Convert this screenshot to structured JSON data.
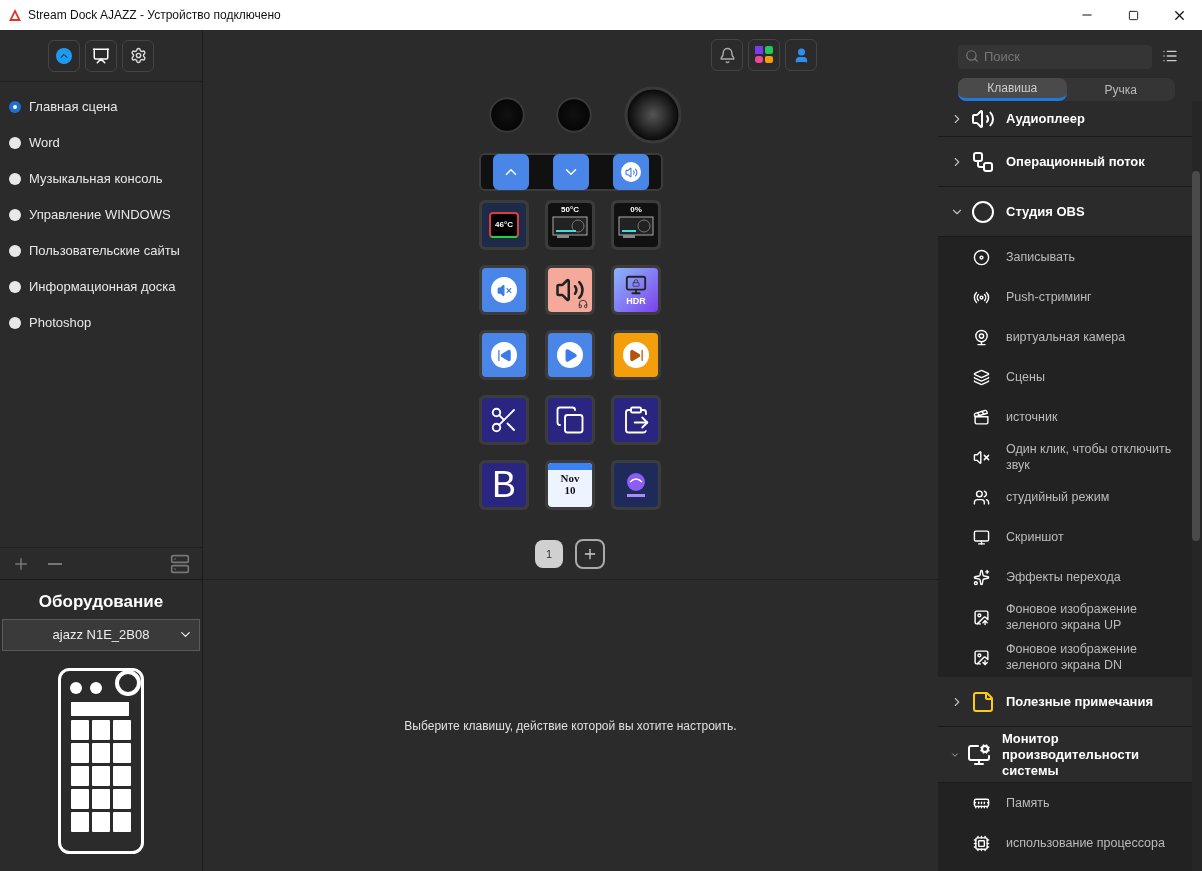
{
  "window": {
    "title": "Stream Dock AJAZZ - Устройство подключено"
  },
  "scenes": [
    {
      "label": "Главная сцена",
      "selected": true
    },
    {
      "label": "Word",
      "selected": false
    },
    {
      "label": "Музыкальная консоль",
      "selected": false
    },
    {
      "label": "Управление WINDOWS",
      "selected": false
    },
    {
      "label": "Пользовательские сайты",
      "selected": false
    },
    {
      "label": "Информационная доска",
      "selected": false
    },
    {
      "label": "Photoshop",
      "selected": false
    }
  ],
  "hardware": {
    "title": "Оборудование",
    "device": "ajazz N1E_2B08"
  },
  "device": {
    "strip": [
      {
        "kind": "up"
      },
      {
        "kind": "down"
      },
      {
        "kind": "volume"
      }
    ],
    "keys": [
      {
        "kind": "cpu-temp",
        "text": "46°C"
      },
      {
        "kind": "gpu-temp",
        "text": "50°C"
      },
      {
        "kind": "gpu-load",
        "text": "0%"
      },
      {
        "kind": "mute"
      },
      {
        "kind": "speaker"
      },
      {
        "kind": "hdr",
        "text": "HDR"
      },
      {
        "kind": "previous"
      },
      {
        "kind": "play-pause"
      },
      {
        "kind": "next"
      },
      {
        "kind": "cut"
      },
      {
        "kind": "copy"
      },
      {
        "kind": "paste"
      },
      {
        "kind": "bold",
        "text": "B"
      },
      {
        "kind": "calendar",
        "month": "Nov",
        "day": "10"
      },
      {
        "kind": "obs"
      }
    ]
  },
  "pages": [
    {
      "label": "1",
      "selected": true
    }
  ],
  "hint": "Выберите клавишу, действие которой вы хотите настроить.",
  "library": {
    "search": {
      "placeholder": "Поиск"
    },
    "tabs": [
      {
        "label": "Клавиша",
        "selected": true
      },
      {
        "label": "Ручка",
        "selected": false
      }
    ],
    "categories": [
      {
        "name": "Аудиоплеер",
        "expanded": false
      },
      {
        "name": "Операционный поток",
        "expanded": false
      },
      {
        "name": "Студия OBS",
        "expanded": true,
        "children": [
          {
            "label": "Записывать"
          },
          {
            "label": "Push-стриминг"
          },
          {
            "label": "виртуальная камера"
          },
          {
            "label": "Сцены"
          },
          {
            "label": "источник"
          },
          {
            "label": "Один клик, чтобы отключить звук"
          },
          {
            "label": "студийный режим"
          },
          {
            "label": "Скриншот"
          },
          {
            "label": "Эффекты перехода"
          },
          {
            "label": "Фоновое изображение зеленого экрана UP"
          },
          {
            "label": "Фоновое изображение зеленого экрана DN"
          }
        ]
      },
      {
        "name": "Полезные примечания",
        "expanded": false
      },
      {
        "name": "Монитор производительности системы",
        "expanded": true,
        "children": [
          {
            "label": "Память"
          },
          {
            "label": "использование процессора"
          }
        ]
      }
    ]
  }
}
